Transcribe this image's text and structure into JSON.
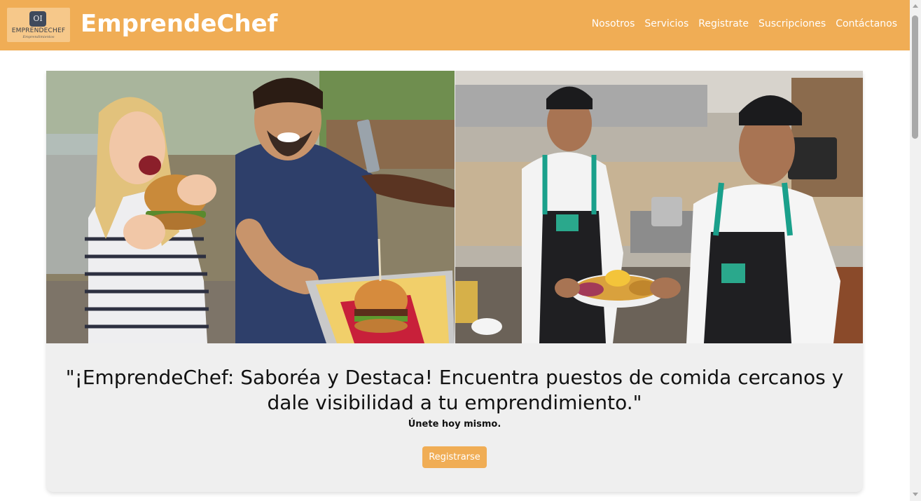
{
  "header": {
    "logo": {
      "word": "EMPRENDECHEF",
      "sub": "Emprendimientos",
      "glyph": "OI"
    },
    "brand": "EmprendeChef",
    "nav": [
      "Nosotros",
      "Servicios",
      "Registrate",
      "Suscripciones",
      "Contáctanos"
    ]
  },
  "hero": {
    "title": "\"¡EmprendeChef: Saboréa y Destaca! Encuentra puestos de comida cercanos y dale visibilidad a tu emprendimiento.\"",
    "subtitle": "Únete hoy mismo.",
    "cta_label": "Registrarse"
  },
  "colors": {
    "accent": "#f0ad55",
    "card_bg": "#efefef"
  }
}
